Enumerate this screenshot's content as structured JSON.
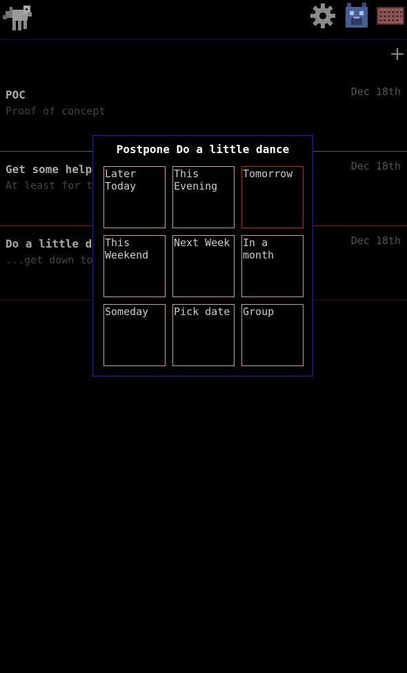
{
  "toolbar": {
    "logo_icon": "pixel-unicorn-icon",
    "settings_icon": "gear-icon",
    "profile_icon": "pixel-cat-icon",
    "calendar_icon": "pixel-calendar-icon"
  },
  "list": {
    "add_label": "+",
    "items": [
      {
        "title": "POC",
        "desc": "Proof of concept",
        "date": "Dec 18th",
        "sep_color": "#555555"
      },
      {
        "title": "Get some help",
        "desc": "At least for t",
        "date": "Dec 18th",
        "sep_color": "#7a1a1a"
      },
      {
        "title": "Do a little da",
        "desc": "...get down to",
        "date": "Dec 18th",
        "sep_color": "#3a0a0a"
      }
    ]
  },
  "dialog": {
    "title": "Postpone Do a little dance",
    "options": [
      {
        "label": "Later Today",
        "selected": false
      },
      {
        "label": "This Evening",
        "selected": false
      },
      {
        "label": "Tomorrow",
        "selected": true
      },
      {
        "label": "This Weekend",
        "selected": false
      },
      {
        "label": "Next Week",
        "selected": false
      },
      {
        "label": "In a month",
        "selected": false
      },
      {
        "label": "Someday",
        "selected": false
      },
      {
        "label": "Pick date",
        "selected": false
      },
      {
        "label": "Group",
        "selected": false
      }
    ]
  },
  "colors": {
    "dialog_border": "#1a1ac8",
    "selected_border": "#d01a1a",
    "option_border": "#c8a0a0"
  }
}
